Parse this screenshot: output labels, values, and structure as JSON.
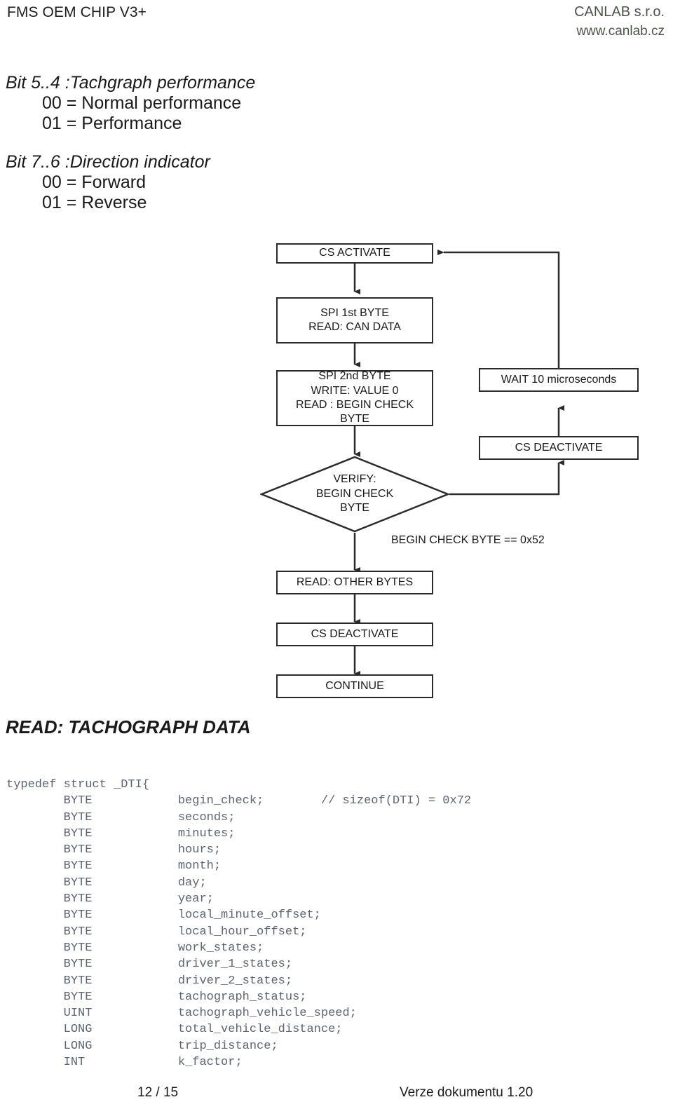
{
  "header": {
    "title": "FMS OEM CHIP V3+",
    "company": "CANLAB s.r.o.",
    "website": "www.canlab.cz",
    "company_color": "#4a5448"
  },
  "bit_definitions": [
    {
      "heading": "Bit  5..4 :Tachgraph performance",
      "options": [
        "00 = Normal performance",
        "01 = Performance"
      ]
    },
    {
      "heading": "Bit  7..6 :Direction indicator",
      "options": [
        "00 = Forward",
        "01 = Reverse"
      ]
    }
  ],
  "flowchart": {
    "boxes": {
      "cs_activate": "CS ACTIVATE",
      "spi_1st_byte": "SPI 1st BYTE\nREAD: CAN DATA",
      "spi_2nd_byte": "SPI 2nd BYTE\nWRITE: VALUE 0\nREAD : BEGIN CHECK\nBYTE",
      "verify_diamond": "VERIFY:\nBEGIN CHECK\nBYTE",
      "wait_micro": "WAIT 10 microseconds",
      "cs_deactivate_right": "CS DEACTIVATE",
      "read_other_bytes": "READ: OTHER BYTES",
      "cs_deactivate_bottom": "CS DEACTIVATE",
      "continue": "CONTINUE"
    },
    "edge_labels": {
      "begin_check_condition": "BEGIN CHECK BYTE == 0x52"
    }
  },
  "section": {
    "heading": "READ: TACHOGRAPH DATA"
  },
  "code": {
    "language": "c",
    "text_color": "#5c6472",
    "lines": [
      "typedef struct _DTI{",
      "        BYTE            begin_check;        // sizeof(DTI) = 0x72",
      "        BYTE            seconds;",
      "        BYTE            minutes;",
      "        BYTE            hours;",
      "        BYTE            month;",
      "        BYTE            day;",
      "        BYTE            year;",
      "        BYTE            local_minute_offset;",
      "        BYTE            local_hour_offset;",
      "        BYTE            work_states;",
      "        BYTE            driver_1_states;",
      "        BYTE            driver_2_states;",
      "        BYTE            tachograph_status;",
      "        UINT            tachograph_vehicle_speed;",
      "        LONG            total_vehicle_distance;",
      "        LONG            trip_distance;",
      "        INT             k_factor;"
    ]
  },
  "footer": {
    "page_number": "12 / 15",
    "doc_version": "Verze dokumentu 1.20"
  }
}
